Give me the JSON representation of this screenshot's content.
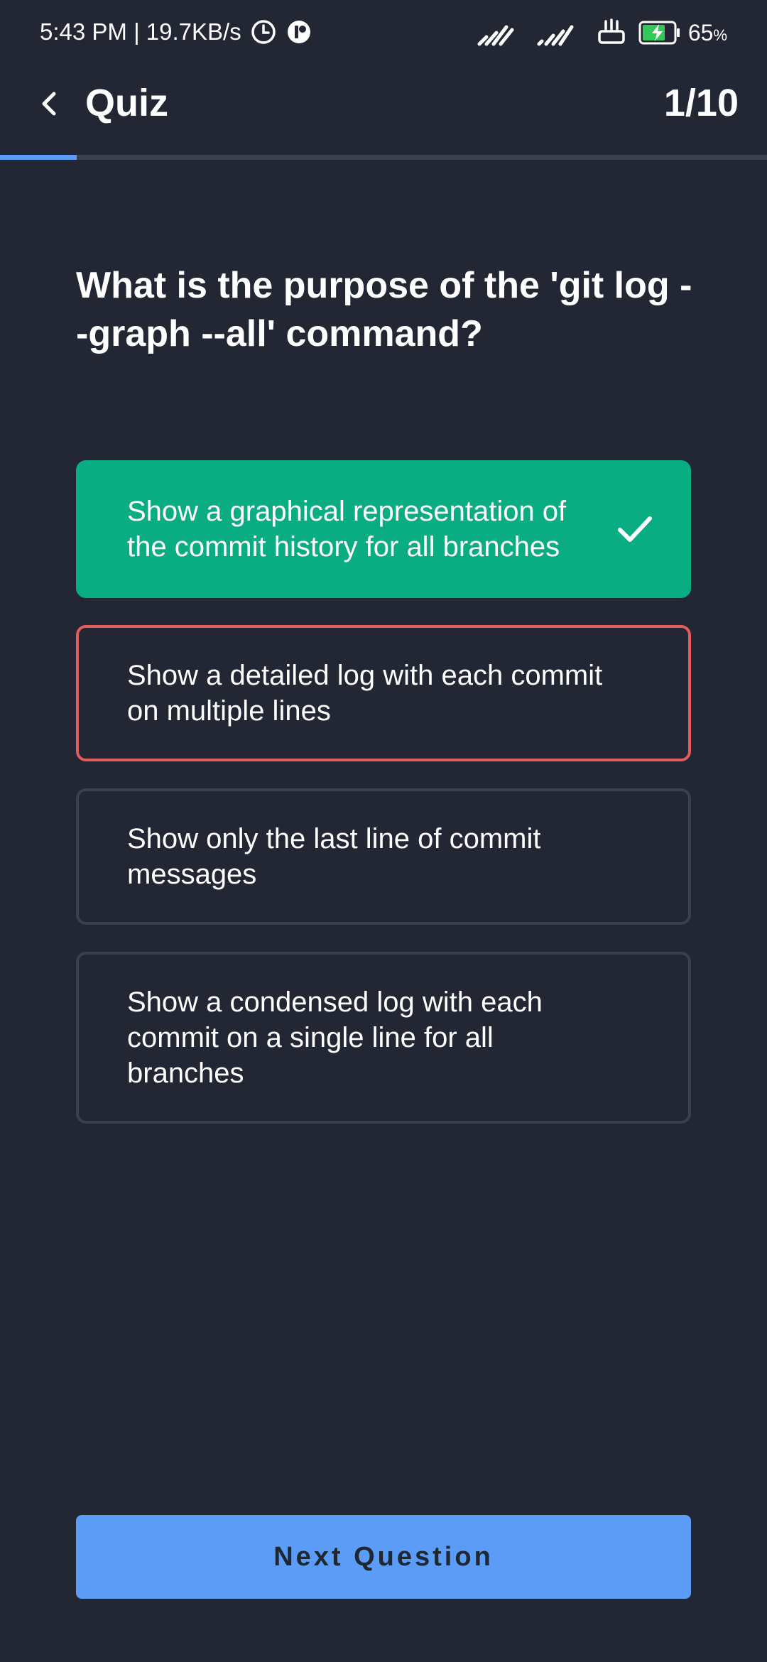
{
  "status_bar": {
    "time_speed": "5:43 PM | 19.7KB/s",
    "battery_value": "65",
    "battery_unit": "%",
    "icons": [
      "alarm-icon",
      "app-notification-icon",
      "signal-icon",
      "signal-icon",
      "router-icon",
      "battery-charging-icon"
    ]
  },
  "app_bar": {
    "title": "Quiz",
    "progress_text": "1/10",
    "progress_fraction": 0.1
  },
  "question": {
    "text": "What is the purpose of the 'git log --graph --all' command?"
  },
  "options": [
    {
      "text": "Show a graphical representation of the commit history for all branches",
      "state": "correct"
    },
    {
      "text": "Show a detailed log with each commit on multiple lines",
      "state": "wrong"
    },
    {
      "text": "Show only the last line of commit messages",
      "state": "neutral"
    },
    {
      "text": "Show a condensed log with each commit on a single line for all branches",
      "state": "neutral"
    }
  ],
  "next_button": {
    "label": "Next Question"
  },
  "colors": {
    "background": "#222733",
    "correct": "#0aac82",
    "wrong": "#e35d5d",
    "accent": "#5b9cf6",
    "option_border": "#3b404b"
  }
}
